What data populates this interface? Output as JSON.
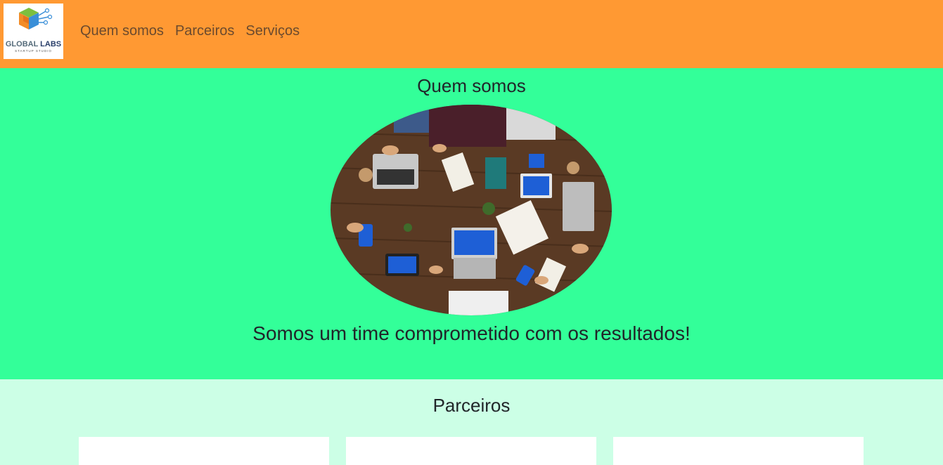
{
  "colors": {
    "navbar_bg": "#ff9933",
    "about_bg": "#33ff99",
    "partners_bg": "#ccffe6",
    "nav_link": "#6b4a2e",
    "card_bg": "#ffffff"
  },
  "header": {
    "logo_text_primary": "GLOBAL",
    "logo_text_secondary": "LABS",
    "logo_subtext": "STARTUP STUDIO",
    "nav": [
      {
        "label": "Quem somos",
        "icon": null
      },
      {
        "label": "Parceiros",
        "icon": null
      },
      {
        "label": "Serviços",
        "icon": null
      }
    ]
  },
  "about": {
    "title": "Quem somos",
    "image_icon": "team-photo",
    "tagline": "Somos um time comprometido com os resultados!"
  },
  "partners": {
    "title": "Parceiros",
    "cards": [
      {
        "label": ""
      },
      {
        "label": ""
      },
      {
        "label": ""
      }
    ]
  }
}
